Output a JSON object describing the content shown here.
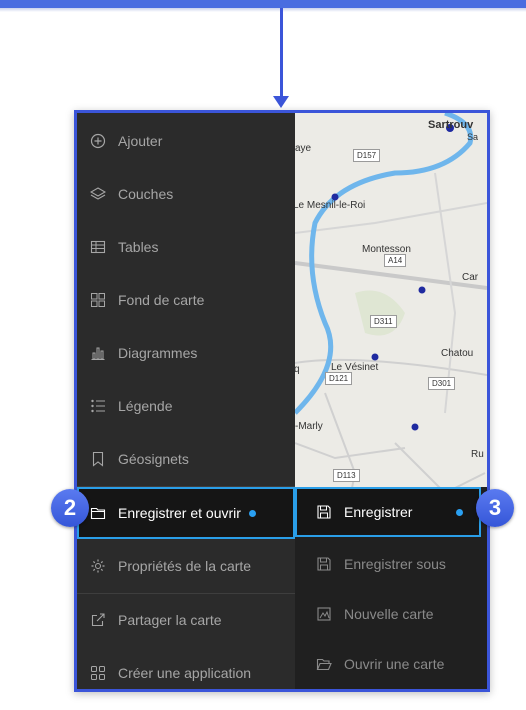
{
  "colors": {
    "accent": "#2a9ee8",
    "callout": "#3b55d9",
    "sidebar_bg": "#2b2b2b",
    "submenu_bg": "#202020"
  },
  "sidebar": {
    "items": [
      {
        "label": "Ajouter",
        "icon": "add-circle-icon"
      },
      {
        "label": "Couches",
        "icon": "layers-icon"
      },
      {
        "label": "Tables",
        "icon": "table-icon"
      },
      {
        "label": "Fond de carte",
        "icon": "basemap-icon"
      },
      {
        "label": "Diagrammes",
        "icon": "chart-icon"
      },
      {
        "label": "Légende",
        "icon": "legend-icon"
      },
      {
        "label": "Géosignets",
        "icon": "bookmark-icon"
      },
      {
        "label": "Enregistrer et ouvrir",
        "icon": "folder-icon",
        "active": true
      },
      {
        "label": "Propriétés de la carte",
        "icon": "gear-icon"
      },
      {
        "label": "Partager la carte",
        "icon": "share-icon"
      },
      {
        "label": "Créer une application",
        "icon": "app-grid-icon"
      }
    ]
  },
  "submenu": {
    "items": [
      {
        "label": "Enregistrer",
        "icon": "save-icon",
        "active": true
      },
      {
        "label": "Enregistrer sous",
        "icon": "save-as-icon"
      },
      {
        "label": "Nouvelle carte",
        "icon": "new-map-icon"
      },
      {
        "label": "Ouvrir une carte",
        "icon": "open-folder-icon"
      }
    ]
  },
  "callouts": {
    "step_2": "2",
    "step_3": "3"
  },
  "map": {
    "place_labels": {
      "sartrouville": "Sartrouv",
      "sa": "Sa",
      "aye": "aye",
      "mesnil": "Le Mesnil-le-Roi",
      "montesson": "Montesson",
      "car": "Car",
      "chatou": "Chatou",
      "q": "q",
      "vesinet": "Le Vésinet",
      "marly": "-Marly",
      "ru": "Ru"
    },
    "road_labels": {
      "d157": "D157",
      "a14": "A14",
      "d311": "D311",
      "d121": "D121",
      "d301": "D301",
      "d113": "D113"
    }
  }
}
